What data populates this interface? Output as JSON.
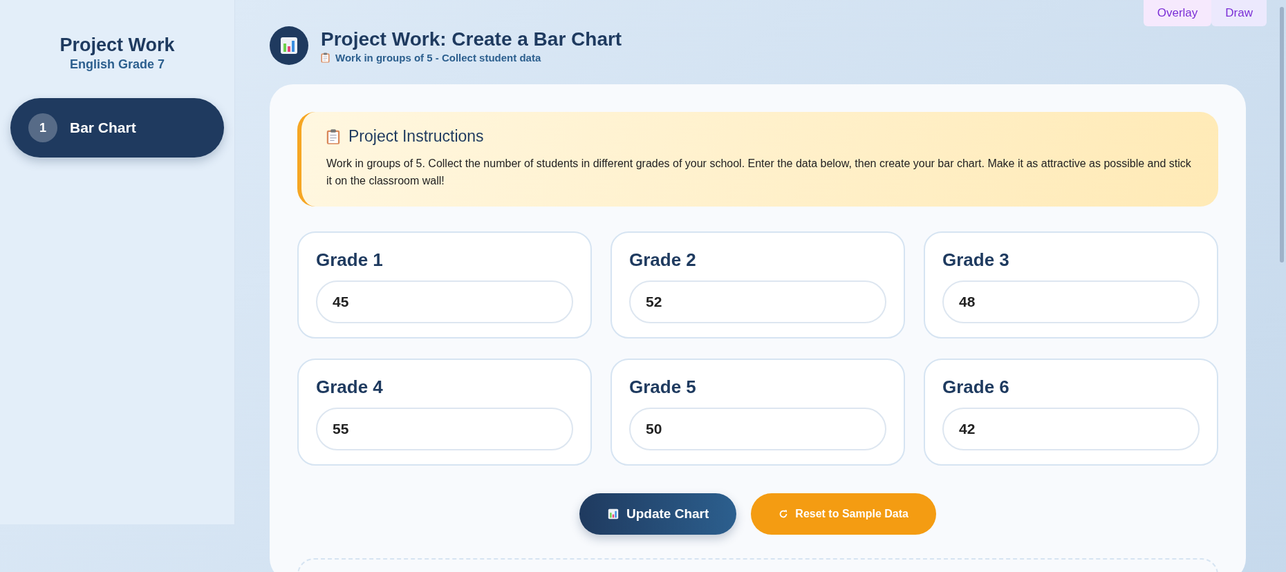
{
  "sidebar": {
    "title": "Project Work",
    "subtitle": "English Grade 7",
    "items": [
      {
        "number": "1",
        "label": "Bar Chart",
        "selected": true
      }
    ]
  },
  "header": {
    "title": "Project Work: Create a Bar Chart",
    "subtitle": "Work in groups of 5 - Collect student data"
  },
  "top_buttons": [
    "Overlay",
    "Draw"
  ],
  "instructions": {
    "title": "Project Instructions",
    "text": "Work in groups of 5. Collect the number of students in different grades of your school. Enter the data below, then create your bar chart. Make it as attractive as possible and stick it on the classroom wall!"
  },
  "grades": [
    {
      "label": "Grade 1",
      "value": "45"
    },
    {
      "label": "Grade 2",
      "value": "52"
    },
    {
      "label": "Grade 3",
      "value": "48"
    },
    {
      "label": "Grade 4",
      "value": "55"
    },
    {
      "label": "Grade 5",
      "value": "50"
    },
    {
      "label": "Grade 6",
      "value": "42"
    }
  ],
  "buttons": [
    {
      "kind": "update",
      "label": "Update Chart"
    },
    {
      "kind": "reset",
      "label": "Reset to Sample Data"
    }
  ]
}
